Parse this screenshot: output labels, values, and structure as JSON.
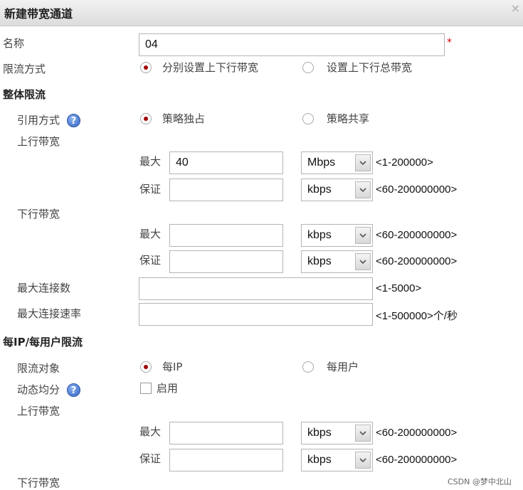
{
  "dialog": {
    "title": "新建带宽通道"
  },
  "name_row": {
    "label": "名称",
    "value": "04",
    "required_mark": "*"
  },
  "mode_row": {
    "label": "限流方式",
    "option_1": "分别设置上下行带宽",
    "option_2": "设置上下行总带宽",
    "selected": 1
  },
  "overall": {
    "section_title": "整体限流",
    "reference_label": "引用方式",
    "reference_option_1": "策略独占",
    "reference_option_2": "策略共享",
    "uplink_label": "上行带宽",
    "uplink_max_label": "最大",
    "uplink_max_value": "40",
    "uplink_max_unit": "Mbps",
    "uplink_max_hint": "<1-200000>",
    "uplink_guarantee_label": "保证",
    "uplink_guarantee_value": "",
    "uplink_guarantee_unit": "kbps",
    "uplink_guarantee_hint": "<60-200000000>",
    "downlink_label": "下行带宽",
    "downlink_max_label": "最大",
    "downlink_max_value": "",
    "downlink_max_unit": "kbps",
    "downlink_max_hint": "<60-200000000>",
    "downlink_guarantee_label": "保证",
    "downlink_guarantee_value": "",
    "downlink_guarantee_unit": "kbps",
    "downlink_guarantee_hint": "<60-200000000>",
    "max_conn_label": "最大连接数",
    "max_conn_value": "",
    "max_conn_hint": "<1-5000>",
    "max_conn_rate_label": "最大连接速率",
    "max_conn_rate_value": "",
    "max_conn_rate_hint": "<1-500000>个/秒"
  },
  "per_ip": {
    "section_title": "每IP/每用户限流",
    "target_label": "限流对象",
    "target_option_1": "每IP",
    "target_option_2": "每用户",
    "dynamic_label": "动态均分",
    "enable_label": "启用",
    "uplink_label": "上行带宽",
    "uplink_max_label": "最大",
    "uplink_max_value": "",
    "uplink_max_unit": "kbps",
    "uplink_max_hint": "<60-200000000>",
    "uplink_guarantee_label": "保证",
    "uplink_guarantee_value": "",
    "uplink_guarantee_unit": "kbps",
    "uplink_guarantee_hint": "<60-200000000>",
    "downlink_label": "下行带宽"
  },
  "help_glyph": "?",
  "icons": {
    "help": "help-icon",
    "dropdown": "chevron-down-icon",
    "close": "close-icon"
  },
  "colors": {
    "radio_selected": "#a30000",
    "required": "#dd0000",
    "help": "#2f62c4"
  },
  "watermark": "CSDN @梦中北山"
}
